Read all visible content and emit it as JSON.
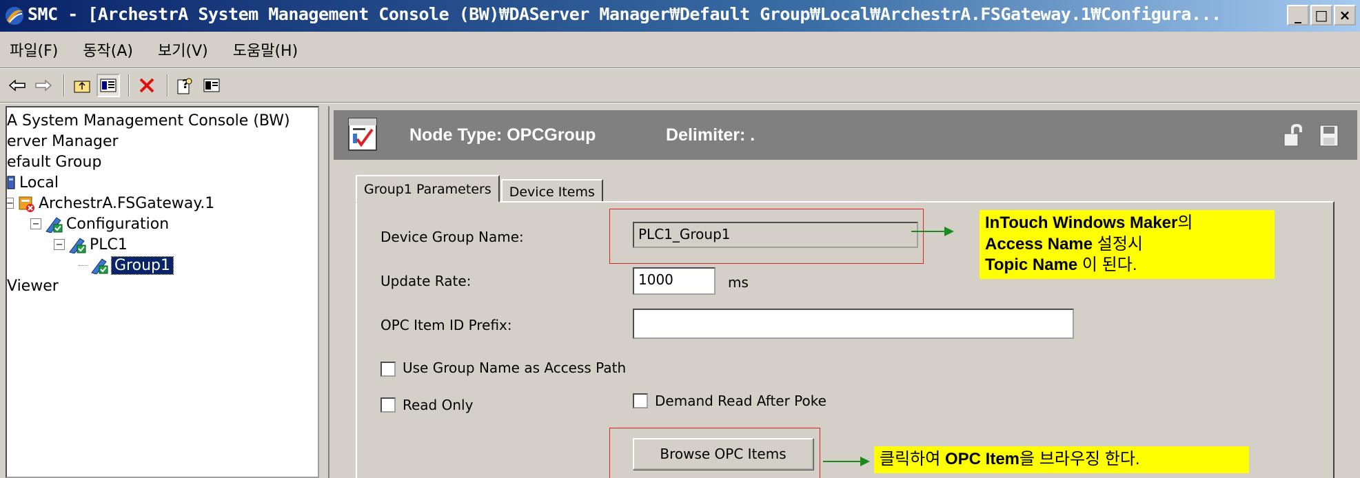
{
  "window": {
    "title": "SMC - [ArchestrA System Management Console (BW)₩DAServer Manager₩Default Group₩Local₩ArchestrA.FSGateway.1₩Configura...",
    "controls": [
      "_",
      "□",
      "×"
    ]
  },
  "menu": [
    "파일(F)",
    "동작(A)",
    "보기(V)",
    "도움말(H)"
  ],
  "toolbar": {
    "icons": [
      "back-icon",
      "forward-icon",
      "up-folder-icon",
      "show-hide-tree-icon",
      "delete-icon",
      "help-icon",
      "description-icon"
    ]
  },
  "tree": {
    "items": [
      {
        "label": "A System Management Console (BW)"
      },
      {
        "label": "erver Manager"
      },
      {
        "label": "efault Group"
      },
      {
        "label": "Local"
      },
      {
        "label": "ArchestrA.FSGateway.1"
      },
      {
        "label": "Configuration"
      },
      {
        "label": "PLC1"
      },
      {
        "label": "Group1"
      },
      {
        "label": "Viewer"
      }
    ]
  },
  "header": {
    "node_type": "Node Type: OPCGroup",
    "delimiter": "Delimiter:  ."
  },
  "tabs": [
    "Group1 Parameters",
    "Device Items"
  ],
  "form": {
    "device_group_name_label": "Device Group Name:",
    "device_group_name_value": "PLC1_Group1",
    "update_rate_label": "Update Rate:",
    "update_rate_value": "1000",
    "update_rate_unit": "ms",
    "opc_prefix_label": "OPC Item ID Prefix:",
    "opc_prefix_value": "",
    "use_group_name_label": "Use Group Name as Access Path",
    "read_only_label": "Read Only",
    "demand_read_label": "Demand Read After Poke",
    "browse_button": "Browse OPC Items"
  },
  "annotations": {
    "note1_line1_bold": "InTouch Windows Maker",
    "note1_line1_rest": "의",
    "note1_line2_bold": "Access Name",
    "note1_line2_rest": " 설정시",
    "note1_line3_bold": "Topic Name",
    "note1_line3_rest": " 이 된다.",
    "note2_pre": "클릭하여 ",
    "note2_bold": "OPC Item",
    "note2_post": "을 브라우징 한다."
  },
  "colors": {
    "highlight_box": "#e02020",
    "arrow": "#1a8a1a",
    "note_background": "#ffff00",
    "selection": "#0a246a"
  }
}
